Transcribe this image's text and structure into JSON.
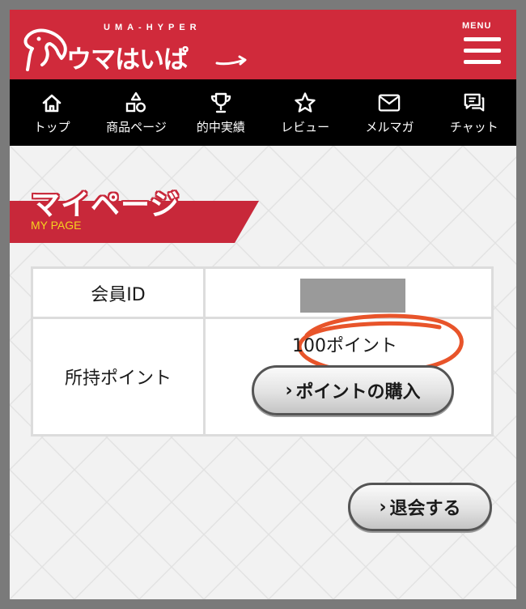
{
  "header": {
    "logo_tagline": "UMA-HYPER",
    "logo_name": "ウマはいぱ",
    "menu_label": "MENU",
    "brand_color": "#d02a3b"
  },
  "nav": {
    "items": [
      {
        "label": "トップ",
        "icon": "home-icon"
      },
      {
        "label": "商品ページ",
        "icon": "shapes-icon"
      },
      {
        "label": "的中実績",
        "icon": "trophy-icon"
      },
      {
        "label": "レビュー",
        "icon": "star-icon"
      },
      {
        "label": "メルマガ",
        "icon": "mail-icon"
      },
      {
        "label": "チャット",
        "icon": "chat-icon"
      }
    ]
  },
  "page": {
    "title": "マイページ",
    "subtitle": "MY PAGE"
  },
  "account": {
    "member_id_label": "会員ID",
    "points_label": "所持ポイント",
    "points_value": "100ポイント",
    "buy_button": "ポイントの購入",
    "leave_button": "退会する",
    "chevron": "›"
  }
}
